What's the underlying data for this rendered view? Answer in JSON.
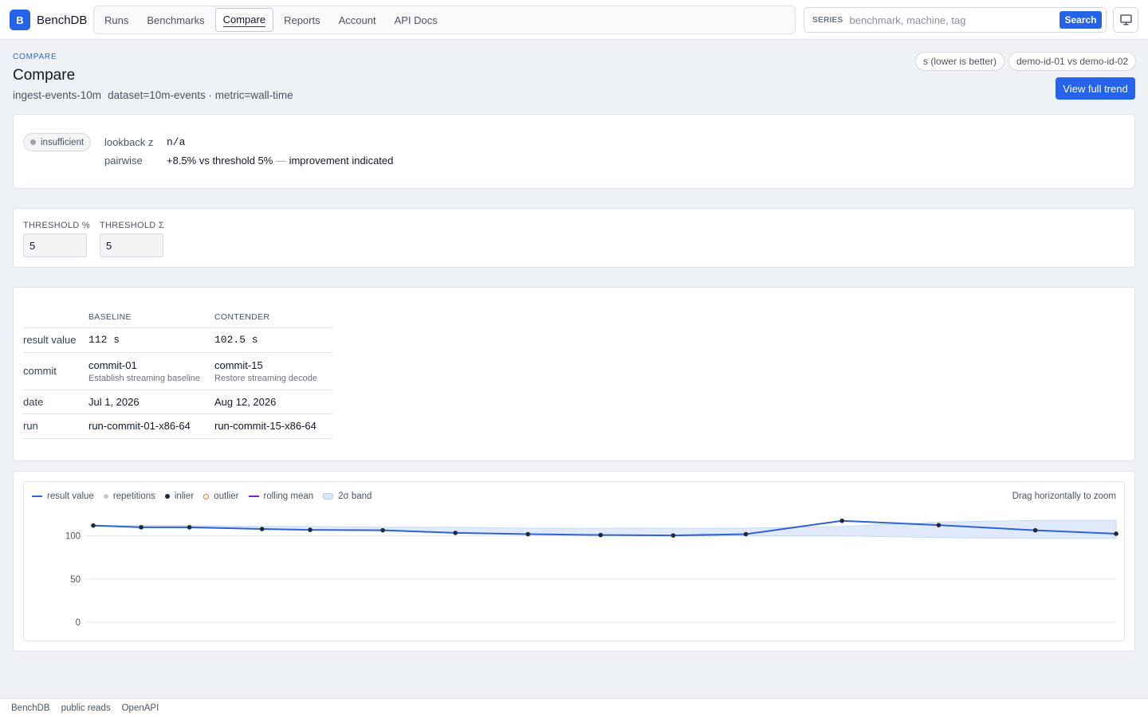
{
  "app": {
    "logo_letter": "B",
    "name": "BenchDB"
  },
  "nav": {
    "items": [
      {
        "label": "Runs"
      },
      {
        "label": "Benchmarks"
      },
      {
        "label": "Compare",
        "active": true
      },
      {
        "label": "Reports"
      },
      {
        "label": "Account"
      },
      {
        "label": "API Docs"
      }
    ]
  },
  "search": {
    "label": "SERIES",
    "placeholder": "benchmark, machine, tag",
    "value": "",
    "button": "Search",
    "icon": "monitor-icon"
  },
  "header": {
    "eyebrow": "COMPARE",
    "title": "Compare",
    "benchmark": "ingest-events-10m",
    "params": "dataset=10m-events · metric=wall-time",
    "unit_chip": "s (lower is better)",
    "pair_chip": "demo-id-01 vs demo-id-02",
    "trend_button": "View full trend"
  },
  "status": {
    "badge": "insufficient",
    "lookback_label": "lookback z",
    "lookback_value": "n/a",
    "pairwise_label": "pairwise",
    "pairwise_value": "+8.5% vs threshold 5%",
    "pairwise_dash": "—",
    "pairwise_note": "improvement indicated"
  },
  "thresholds": {
    "pct_label": "THRESHOLD %",
    "pct_value": "5",
    "sigma_label": "THRESHOLD Σ",
    "sigma_value": "5"
  },
  "comparison": {
    "headers": {
      "baseline": "BASELINE",
      "contender": "CONTENDER"
    },
    "rows": {
      "result": {
        "label": "result value",
        "baseline": "112 s",
        "contender": "102.5 s"
      },
      "commit": {
        "label": "commit",
        "baseline": "commit-01",
        "baseline_note": "Establish streaming baseline",
        "contender": "commit-15",
        "contender_note": "Restore streaming decode"
      },
      "date": {
        "label": "date",
        "baseline": "Jul 1, 2026",
        "contender": "Aug 12, 2026"
      },
      "run": {
        "label": "run",
        "baseline": "run-commit-01-x86-64",
        "contender": "run-commit-15-x86-64"
      }
    }
  },
  "legend": {
    "result_value": "result value",
    "repetitions": "repetitions",
    "inlier": "inlier",
    "outlier": "outlier",
    "rolling_mean": "rolling mean",
    "band": "2σ band",
    "zoom_hint": "Drag horizontally to zoom"
  },
  "colors": {
    "accent": "#2563eb",
    "line": "#2f62d6",
    "rolling_mean": "#7e22ce",
    "outlier": "#f97316",
    "band": "#dbe7fb"
  },
  "chart_data": {
    "type": "line",
    "series": [
      {
        "name": "result value",
        "values": [
          112,
          110,
          110,
          108,
          107,
          106.5,
          103.5,
          102,
          101,
          100.5,
          102,
          117.5,
          112.5,
          106.5,
          102.5
        ]
      }
    ],
    "band": {
      "upper": [
        112,
        112,
        112,
        111,
        111,
        110,
        110,
        109,
        109,
        109,
        109,
        111,
        116,
        118,
        118
      ],
      "lower": [
        112,
        110,
        109,
        108,
        107,
        106,
        104,
        102,
        101,
        100,
        100,
        100,
        98,
        97,
        97
      ]
    },
    "x_index": [
      0,
      1,
      2,
      3,
      4,
      5,
      6,
      7,
      8,
      9,
      10,
      11,
      12,
      13,
      14
    ],
    "yticks": [
      0,
      50,
      100
    ],
    "ylim": [
      0,
      120
    ],
    "grid": true,
    "legend": "top-left"
  },
  "footer": {
    "items": [
      "BenchDB",
      "public reads",
      "OpenAPI"
    ]
  }
}
